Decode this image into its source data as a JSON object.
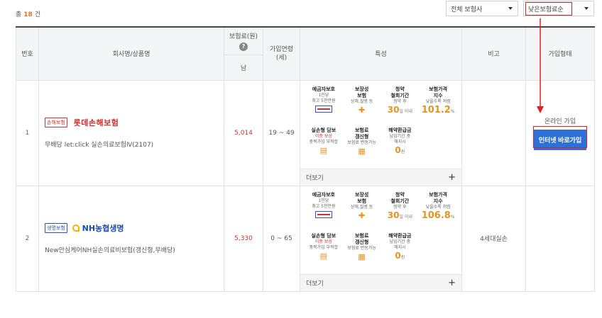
{
  "summary": {
    "prefix": "총",
    "count": "18",
    "suffix": "건"
  },
  "filters": {
    "company": "전체 보험사",
    "sort": "낮은보험료순"
  },
  "table": {
    "headers": {
      "no": "번호",
      "company_product": "회사명/상품명",
      "premium": "보험료(원)",
      "premium_sub": "남",
      "age": "가입연령\n(세)",
      "features": "특성",
      "note": "비고",
      "join_type": "가입형태"
    },
    "rows": [
      {
        "no": "1",
        "badge": "손해보험",
        "brand": "롯데손해보험",
        "product": "무배당 let:click 실손의료보험Ⅳ(2107)",
        "premium": "5,014",
        "age": "19 ~ 49",
        "note": "",
        "features": {
          "deposit_title": "예금자보호",
          "deposit_sub1": "1인당",
          "deposit_sub2": "최고 5천만원",
          "compensation_title": "보장성\n보험",
          "compensation_sub": "상해,질병 등",
          "withdrawal_title": "청약\n철회기간",
          "withdrawal_sub": "청약 후",
          "withdrawal_value": "30",
          "withdrawal_unit": "일 이내",
          "price_index_title": "보험가격\n지수",
          "price_index_sub": "낮을수록 저렴",
          "price_index_value": "101.2",
          "price_index_unit": "%",
          "actual_loss_title": "실손형 담보",
          "actual_loss_red": "이중 보상",
          "actual_loss_sub": "중복가입 부적합",
          "renewal_title": "보험료\n갱신형",
          "renewal_sub": "보험료 변동가능",
          "refund_title": "해약환급금",
          "refund_sub1": "납입기간 중",
          "refund_sub2": "해지시",
          "refund_value": "0",
          "refund_unit": "원",
          "more": "더보기"
        },
        "join_label": "온라인 가입",
        "join_button": "인터넷 바로가입"
      },
      {
        "no": "2",
        "badge": "생명보험",
        "brand": "NH농협생명",
        "product": "New안심케어NH실손의료비보험(갱신형,무배당)",
        "premium": "5,330",
        "age": "0 ~ 65",
        "note": "4세대실손",
        "features": {
          "deposit_title": "예금자보호",
          "deposit_sub1": "1인당",
          "deposit_sub2": "최고 5천만원",
          "compensation_title": "보장성\n보험",
          "compensation_sub": "상해,질병 등",
          "withdrawal_title": "청약\n철회기간",
          "withdrawal_sub": "청약 후",
          "withdrawal_value": "30",
          "withdrawal_unit": "일 이내",
          "price_index_title": "보험가격\n지수",
          "price_index_sub": "낮을수록 저렴",
          "price_index_value": "106.8",
          "price_index_unit": "%",
          "actual_loss_title": "실손형 담보",
          "actual_loss_red": "이중 보상",
          "actual_loss_sub": "중복가입 부적합",
          "renewal_title": "보험료\n갱신형",
          "renewal_sub": "보험료 변동가능",
          "refund_title": "해약환급금",
          "refund_sub1": "납입기간 중",
          "refund_sub2": "해지시",
          "refund_value": "0",
          "refund_unit": "원",
          "more": "더보기"
        },
        "join_label": "",
        "join_button": ""
      }
    ]
  },
  "colors": {
    "accent": "#e8731e",
    "button": "#2f6fd8",
    "highlight": "#e02020"
  }
}
